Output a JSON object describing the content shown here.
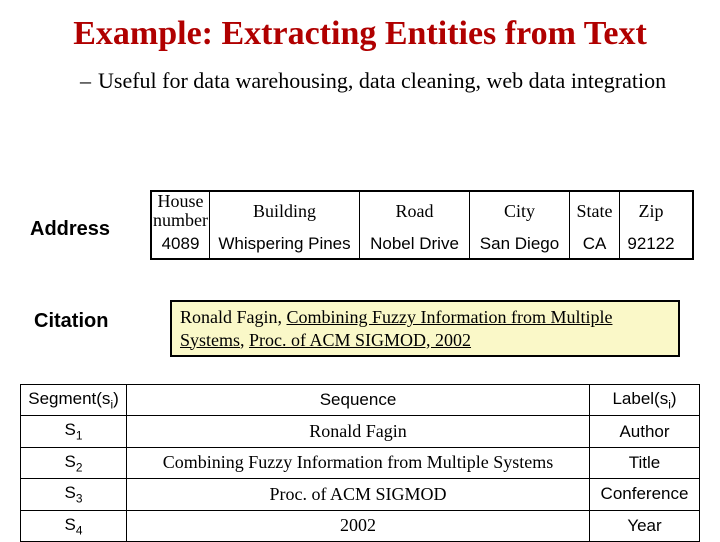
{
  "title": "Example: Extracting Entities from Text",
  "bullet_dash": "–",
  "bullet_text": "Useful for data warehousing, data cleaning, web data integration",
  "address": {
    "label": "Address",
    "headers": {
      "house_number": "House number",
      "building": "Building",
      "road": "Road",
      "city": "City",
      "state": "State",
      "zip": "Zip"
    },
    "values": {
      "house_number": "4089",
      "building": "Whispering Pines",
      "road": "Nobel Drive",
      "city": "San Diego",
      "state": "CA",
      "zip": "92122"
    }
  },
  "citation": {
    "label": "Citation",
    "author": "Ronald Fagin",
    "sep1": ", ",
    "title_underlined": "Combining Fuzzy Information from Multiple Systems",
    "sep2": ", ",
    "venue_underlined": "Proc. of ACM SIGMOD, 2002"
  },
  "segments": {
    "header_segment_prefix": "Segment(s",
    "header_segment_sub": "i",
    "header_segment_suffix": ")",
    "header_sequence": "Sequence",
    "header_label_prefix": "Label(s",
    "header_label_sub": "i",
    "header_label_suffix": ")",
    "rows": [
      {
        "id_prefix": "S",
        "id_sub": "1",
        "sequence": "Ronald Fagin",
        "label": "Author"
      },
      {
        "id_prefix": "S",
        "id_sub": "2",
        "sequence": "Combining Fuzzy Information from Multiple Systems",
        "label": "Title"
      },
      {
        "id_prefix": "S",
        "id_sub": "3",
        "sequence": "Proc. of ACM SIGMOD",
        "label": "Conference"
      },
      {
        "id_prefix": "S",
        "id_sub": "4",
        "sequence": "2002",
        "label": "Year"
      }
    ]
  }
}
